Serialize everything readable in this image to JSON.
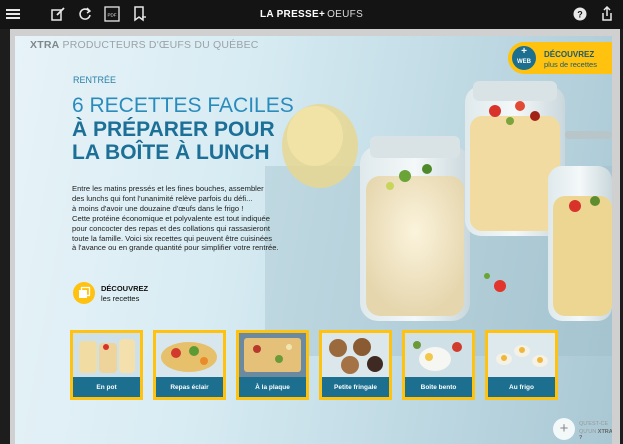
{
  "topbar": {
    "title_bold": "LA PRESSE+",
    "title_sub": "OEUFS"
  },
  "page": {
    "brand_bold": "XTRA",
    "brand_rest": "PRODUCTEURS D'ŒUFS DU QUÉBEC",
    "web_badge": {
      "circle": "+ WEB",
      "line1": "DÉCOUVREZ",
      "line2": "plus de recettes"
    },
    "kicker": "RENTRÉE",
    "headline_1": "6 RECETTES FACILES",
    "headline_2": "À PRÉPARER POUR",
    "headline_3": "LA BOÎTE À LUNCH",
    "body_lines": [
      "Entre les matins pressés et les fines bouches, assembler",
      "des lunchs qui font l'unanimité relève parfois du défi...",
      "à moins d'avoir une douzaine d'œufs dans le frigo !",
      "Cette protéine économique et polyvalente est tout indiquée",
      "pour concocter des repas et des collations qui rassasieront",
      "toute la famille. Voici six recettes qui peuvent être cuisinées",
      "à l'avance ou en grande quantité pour simplifier votre rentrée."
    ],
    "cta_line1": "DÉCOUVREZ",
    "cta_line2": "les recettes",
    "tiles": [
      {
        "label": "En pot"
      },
      {
        "label": "Repas éclair"
      },
      {
        "label": "À la plaque"
      },
      {
        "label": "Petite fringale"
      },
      {
        "label": "Boîte bento"
      },
      {
        "label": "Au frigo"
      }
    ],
    "xtra_question_1": "QU'EST-CE",
    "xtra_question_2a": "QU'UN",
    "xtra_question_2b": "XTRA ?"
  },
  "colors": {
    "accent_yellow": "#ffc20e",
    "brand_blue": "#1c6f8f",
    "headline_blue": "#2a8cbc"
  }
}
